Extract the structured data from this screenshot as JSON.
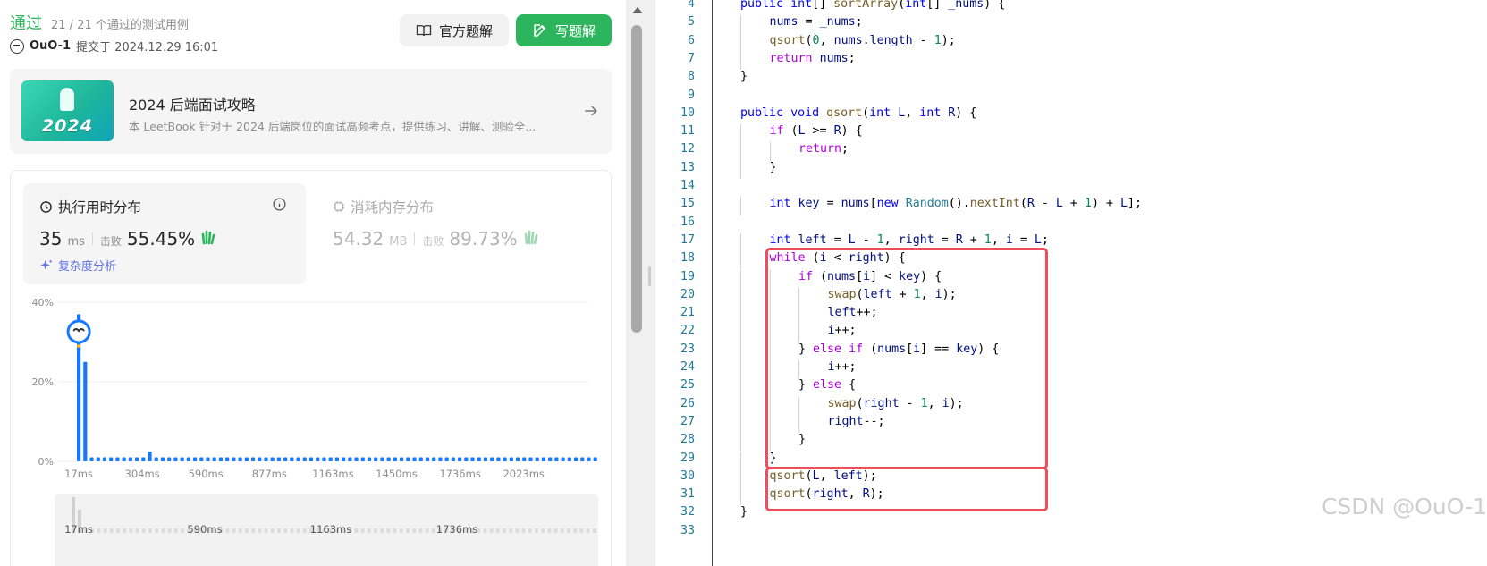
{
  "result": {
    "status": "通过",
    "cases": "21 / 21 个通过的测试用例",
    "user": "OuO-1",
    "submitted": "提交于 2024.12.29 16:01",
    "official_solution": "官方题解",
    "write_solution": "写题解"
  },
  "book": {
    "cover_text": "2024",
    "title": "2024 后端面试攻略",
    "desc": "本 LeetBook 针对于 2024 后端岗位的面试高频考点，提供练习、讲解、测验全..."
  },
  "runtime": {
    "title": "执行用时分布",
    "value": "35",
    "unit": "ms",
    "beat_label": "击败",
    "percent": "55.45%",
    "complexity": "复杂度分析"
  },
  "memory": {
    "title": "消耗内存分布",
    "value": "54.32",
    "unit": "MB",
    "beat_label": "击败",
    "percent": "89.73%"
  },
  "chart_data": {
    "type": "bar",
    "ylim": [
      0,
      40
    ],
    "y_ticks": [
      "40%",
      "20%",
      "0%"
    ],
    "x_ticks": [
      "17ms",
      "304ms",
      "590ms",
      "877ms",
      "1163ms",
      "1450ms",
      "1736ms",
      "2023ms"
    ],
    "values": [
      37,
      25,
      1,
      1,
      1,
      1,
      1,
      1,
      1,
      1,
      1,
      2.5,
      1,
      1,
      1,
      1,
      1,
      1,
      1,
      1,
      1,
      1,
      1,
      1,
      1,
      1,
      1,
      1,
      1,
      1,
      1,
      1,
      1,
      1,
      1,
      1,
      1,
      1,
      1,
      1,
      1,
      1,
      1,
      1,
      1,
      1,
      1,
      1,
      1,
      1,
      1,
      1,
      1,
      1,
      1,
      1,
      1,
      1,
      1,
      1,
      1,
      1,
      1,
      1,
      1,
      1,
      1,
      1,
      1,
      1,
      1,
      1,
      1,
      1,
      1,
      1,
      1,
      1,
      1,
      1,
      1
    ],
    "mini_ticks": [
      "17ms",
      "590ms",
      "1163ms",
      "1736ms"
    ],
    "bar_color": "#1677ff"
  },
  "code": {
    "lines": [
      {
        "n": "4",
        "indent": 0,
        "h": "<span class='kw'>public</span> <span class='kw'>int</span>[] <span class='fn'>sortArray</span>(<span class='kw'>int</span>[] <span class='var'>_nums</span>) {"
      },
      {
        "n": "5",
        "indent": 1,
        "h": "<span class='var'>nums</span> = <span class='var'>_nums</span>;"
      },
      {
        "n": "6",
        "indent": 1,
        "h": "<span class='fn'>qsort</span>(<span class='num-c'>0</span>, <span class='var'>nums</span>.<span class='var'>length</span> - <span class='num-c'>1</span>);"
      },
      {
        "n": "7",
        "indent": 1,
        "h": "<span class='ctl'>return</span> <span class='var'>nums</span>;"
      },
      {
        "n": "8",
        "indent": 0,
        "h": "}"
      },
      {
        "n": "9",
        "indent": 0,
        "h": ""
      },
      {
        "n": "10",
        "indent": 0,
        "h": "<span class='kw'>public</span> <span class='kw'>void</span> <span class='fn'>qsort</span>(<span class='kw'>int</span> <span class='var'>L</span>, <span class='kw'>int</span> <span class='var'>R</span>) {"
      },
      {
        "n": "11",
        "indent": 1,
        "h": "<span class='ctl'>if</span> (<span class='var'>L</span> &gt;= <span class='var'>R</span>) {"
      },
      {
        "n": "12",
        "indent": 2,
        "h": "<span class='ctl'>return</span>;"
      },
      {
        "n": "13",
        "indent": 1,
        "h": "}"
      },
      {
        "n": "14",
        "indent": 0,
        "h": ""
      },
      {
        "n": "15",
        "indent": 1,
        "h": "<span class='kw'>int</span> <span class='var'>key</span> = <span class='var'>nums</span>[<span class='kw'>new</span> <span class='ty'>Random</span>().<span class='fn'>nextInt</span>(<span class='var'>R</span> - <span class='var'>L</span> + <span class='num-c'>1</span>) + <span class='var'>L</span>];"
      },
      {
        "n": "16",
        "indent": 0,
        "h": ""
      },
      {
        "n": "17",
        "indent": 1,
        "h": "<span class='kw'>int</span> <span class='var'>left</span> = <span class='var'>L</span> - <span class='num-c'>1</span>, <span class='var'>right</span> = <span class='var'>R</span> + <span class='num-c'>1</span>, <span class='var'>i</span> = <span class='var'>L</span>;"
      },
      {
        "n": "18",
        "indent": 1,
        "h": "<span class='ctl'>while</span> (<span class='var'>i</span> &lt; <span class='var'>right</span>) {"
      },
      {
        "n": "19",
        "indent": 2,
        "h": "<span class='ctl'>if</span> (<span class='var'>nums</span>[<span class='var'>i</span>] &lt; <span class='var'>key</span>) {"
      },
      {
        "n": "20",
        "indent": 3,
        "h": "<span class='fn'>swap</span>(<span class='var'>left</span> + <span class='num-c'>1</span>, <span class='var'>i</span>);"
      },
      {
        "n": "21",
        "indent": 3,
        "h": "<span class='var'>left</span>++;"
      },
      {
        "n": "22",
        "indent": 3,
        "h": "<span class='var'>i</span>++;"
      },
      {
        "n": "23",
        "indent": 2,
        "h": "} <span class='ctl'>else</span> <span class='ctl'>if</span> (<span class='var'>nums</span>[<span class='var'>i</span>] == <span class='var'>key</span>) {"
      },
      {
        "n": "24",
        "indent": 3,
        "h": "<span class='var'>i</span>++;"
      },
      {
        "n": "25",
        "indent": 2,
        "h": "} <span class='ctl'>else</span> {"
      },
      {
        "n": "26",
        "indent": 3,
        "h": "<span class='fn'>swap</span>(<span class='var'>right</span> - <span class='num-c'>1</span>, <span class='var'>i</span>);"
      },
      {
        "n": "27",
        "indent": 3,
        "h": "<span class='var'>right</span>--;"
      },
      {
        "n": "28",
        "indent": 2,
        "h": "}"
      },
      {
        "n": "29",
        "indent": 1,
        "h": "}"
      },
      {
        "n": "30",
        "indent": 1,
        "h": "<span class='fn'>qsort</span>(<span class='var'>L</span>, <span class='var'>left</span>);"
      },
      {
        "n": "31",
        "indent": 1,
        "h": "<span class='fn'>qsort</span>(<span class='var'>right</span>, <span class='var'>R</span>);"
      },
      {
        "n": "32",
        "indent": 0,
        "h": "}"
      },
      {
        "n": "33",
        "indent": 0,
        "h": ""
      }
    ]
  },
  "watermark": "CSDN @OuO-1",
  "colors": {
    "accent_green": "#2db55d",
    "highlight_red": "#f04d5e",
    "link_purple": "#5f6fe8"
  }
}
